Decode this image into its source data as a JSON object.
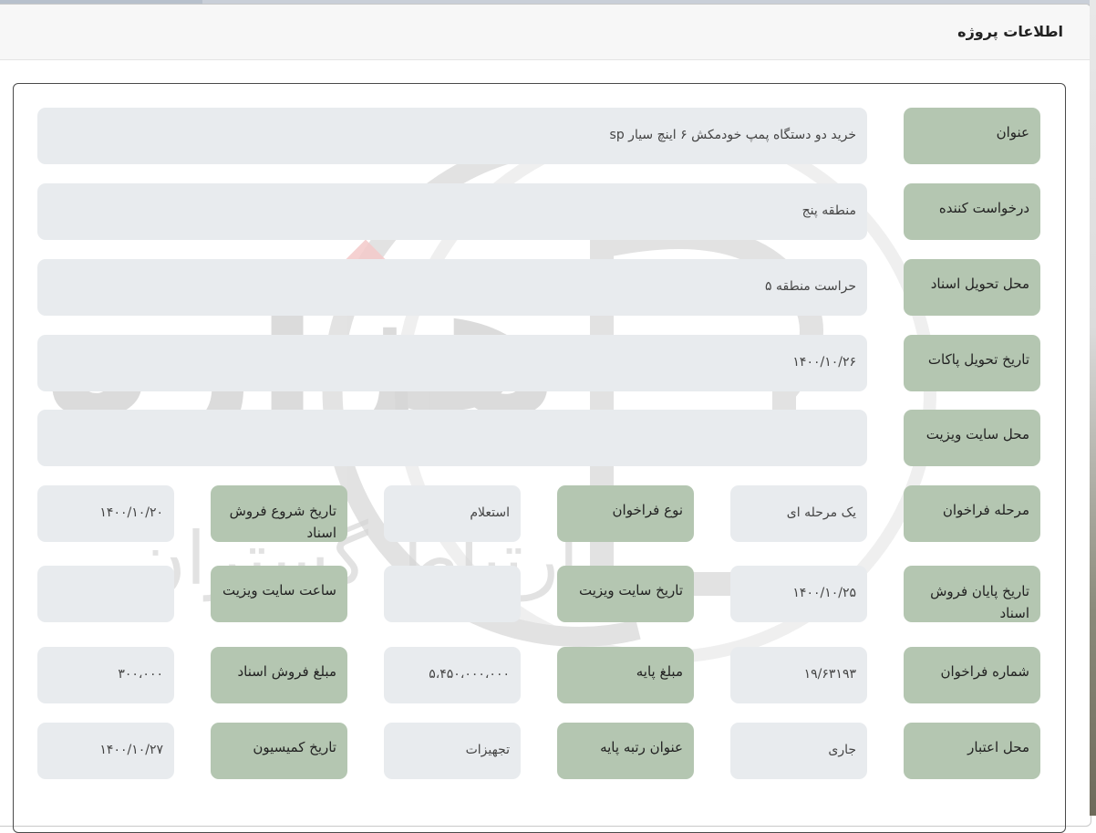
{
  "panel": {
    "title": "اطلاعات پروژه"
  },
  "fields": {
    "title": {
      "label": "عنوان",
      "value": "خرید دو دستگاه پمپ خودمکش ۶ اینچ سیار sp"
    },
    "requester": {
      "label": "درخواست کننده",
      "value": "منطقه پنج"
    },
    "doc_delivery_place": {
      "label": "محل تحویل اسناد",
      "value": "حراست منطقه ۵"
    },
    "packet_delivery_date": {
      "label": "تاریخ تحویل پاکات",
      "value": "۱۴۰۰/۱۰/۲۶"
    },
    "site_visit_place": {
      "label": "محل سایت ویزیت",
      "value": ""
    },
    "call_stage": {
      "label": "مرحله فراخوان",
      "value": "یک مرحله ای"
    },
    "call_type": {
      "label": "نوع فراخوان",
      "value": "استعلام"
    },
    "doc_sale_start": {
      "label": "تاریخ شروع فروش اسناد",
      "value": "۱۴۰۰/۱۰/۲۰"
    },
    "doc_sale_end": {
      "label": "تاریخ پایان فروش اسناد",
      "value": "۱۴۰۰/۱۰/۲۵"
    },
    "site_visit_date": {
      "label": "تاریخ سایت ویزیت",
      "value": ""
    },
    "site_visit_time": {
      "label": "ساعت سایت ویزیت",
      "value": ""
    },
    "call_number": {
      "label": "شماره فراخوان",
      "value": "۱۹/۶۳۱۹۳"
    },
    "base_amount": {
      "label": "مبلغ پایه",
      "value": "۵،۴۵۰،۰۰۰،۰۰۰"
    },
    "doc_sale_amount": {
      "label": "مبلغ فروش اسناد",
      "value": "۳۰۰،۰۰۰"
    },
    "credit_source": {
      "label": "محل اعتبار",
      "value": "جاری"
    },
    "base_grade_title": {
      "label": "عنوان رتبه پایه",
      "value": "تجهیزات"
    },
    "commission_date": {
      "label": "تاریخ کمیسیون",
      "value": "۱۴۰۰/۱۰/۲۷"
    }
  },
  "watermark": {
    "logo_text": "هزاره",
    "sub_text": "ارتباط گستران"
  }
}
